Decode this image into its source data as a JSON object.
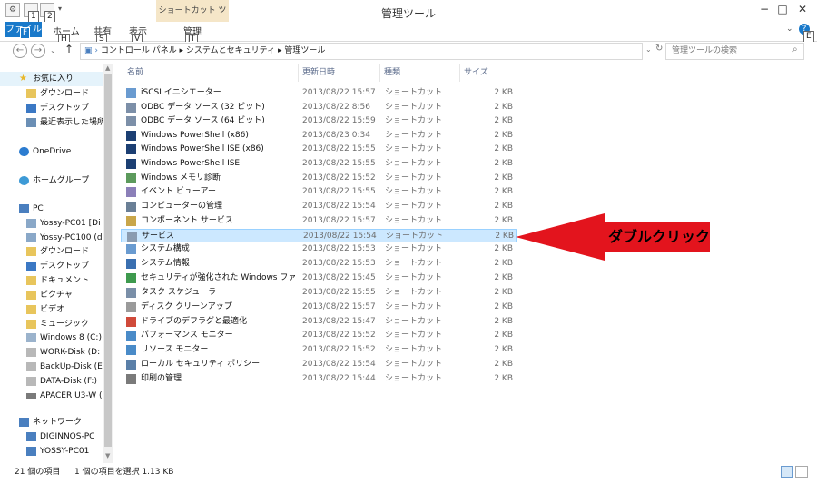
{
  "window": {
    "title": "管理ツール",
    "context_tab": "ショートカット ツール",
    "minimize": "−",
    "maximize": "□",
    "close": "✕"
  },
  "quick_access": {
    "keytip1": "1",
    "keytip2": "2"
  },
  "ribbon": {
    "file": "ファイル",
    "file_keytip": "F",
    "tabs": [
      {
        "label": "ホーム",
        "keytip": "H"
      },
      {
        "label": "共有",
        "keytip": "S"
      },
      {
        "label": "表示",
        "keytip": "V"
      },
      {
        "label": "管理",
        "keytip": "JT"
      }
    ],
    "help_keytip": "E"
  },
  "address": {
    "path": "コントロール パネル ▸ システムとセキュリティ ▸ 管理ツール",
    "search_placeholder": "管理ツールの検索"
  },
  "nav": {
    "favorites": "お気に入り",
    "fav_items": [
      "ダウンロード",
      "デスクトップ",
      "最近表示した場所"
    ],
    "onedrive": "OneDrive",
    "homegroup": "ホームグループ",
    "pc": "PC",
    "pc_items": [
      "Yossy-PC01 [Di",
      "Yossy-PC100 (d",
      "ダウンロード",
      "デスクトップ",
      "ドキュメント",
      "ピクチャ",
      "ビデオ",
      "ミュージック",
      "Windows 8 (C:)",
      "WORK-Disk (D:",
      "BackUp-Disk (E",
      "DATA-Disk (F:)",
      "APACER U3-W ("
    ],
    "network": "ネットワーク",
    "network_items": [
      "DIGINNOS-PC",
      "YOSSY-PC01"
    ]
  },
  "columns": {
    "name": "名前",
    "date": "更新日時",
    "type": "種類",
    "size": "サイズ"
  },
  "files": [
    {
      "name": "iSCSI イニシエーター",
      "date": "2013/08/22 15:57",
      "type": "ショートカット",
      "size": "2 KB"
    },
    {
      "name": "ODBC データ ソース (32 ビット)",
      "date": "2013/08/22 8:56",
      "type": "ショートカット",
      "size": "2 KB"
    },
    {
      "name": "ODBC データ ソース (64 ビット)",
      "date": "2013/08/22 15:59",
      "type": "ショートカット",
      "size": "2 KB"
    },
    {
      "name": "Windows PowerShell (x86)",
      "date": "2013/08/23 0:34",
      "type": "ショートカット",
      "size": "2 KB"
    },
    {
      "name": "Windows PowerShell ISE (x86)",
      "date": "2013/08/22 15:55",
      "type": "ショートカット",
      "size": "2 KB"
    },
    {
      "name": "Windows PowerShell ISE",
      "date": "2013/08/22 15:55",
      "type": "ショートカット",
      "size": "2 KB"
    },
    {
      "name": "Windows メモリ診断",
      "date": "2013/08/22 15:52",
      "type": "ショートカット",
      "size": "2 KB"
    },
    {
      "name": "イベント ビューアー",
      "date": "2013/08/22 15:55",
      "type": "ショートカット",
      "size": "2 KB"
    },
    {
      "name": "コンピューターの管理",
      "date": "2013/08/22 15:54",
      "type": "ショートカット",
      "size": "2 KB"
    },
    {
      "name": "コンポーネント サービス",
      "date": "2013/08/22 15:57",
      "type": "ショートカット",
      "size": "2 KB"
    },
    {
      "name": "サービス",
      "date": "2013/08/22 15:54",
      "type": "ショートカット",
      "size": "2 KB",
      "selected": true
    },
    {
      "name": "システム構成",
      "date": "2013/08/22 15:53",
      "type": "ショートカット",
      "size": "2 KB"
    },
    {
      "name": "システム情報",
      "date": "2013/08/22 15:53",
      "type": "ショートカット",
      "size": "2 KB"
    },
    {
      "name": "セキュリティが強化された Windows ファイア...",
      "date": "2013/08/22 15:45",
      "type": "ショートカット",
      "size": "2 KB"
    },
    {
      "name": "タスク スケジューラ",
      "date": "2013/08/22 15:55",
      "type": "ショートカット",
      "size": "2 KB"
    },
    {
      "name": "ディスク クリーンアップ",
      "date": "2013/08/22 15:57",
      "type": "ショートカット",
      "size": "2 KB"
    },
    {
      "name": "ドライブのデフラグと最適化",
      "date": "2013/08/22 15:47",
      "type": "ショートカット",
      "size": "2 KB"
    },
    {
      "name": "パフォーマンス モニター",
      "date": "2013/08/22 15:52",
      "type": "ショートカット",
      "size": "2 KB"
    },
    {
      "name": "リソース モニター",
      "date": "2013/08/22 15:52",
      "type": "ショートカット",
      "size": "2 KB"
    },
    {
      "name": "ローカル セキュリティ ポリシー",
      "date": "2013/08/22 15:54",
      "type": "ショートカット",
      "size": "2 KB"
    },
    {
      "name": "印刷の管理",
      "date": "2013/08/22 15:44",
      "type": "ショートカット",
      "size": "2 KB"
    }
  ],
  "annotation": {
    "text": "ダブルクリック",
    "color": "#e3141d"
  },
  "status": {
    "count": "21 個の項目",
    "selection": "1 個の項目を選択 1.13 KB"
  },
  "colors": {
    "accent": "#1979ca",
    "selection": "#cce8ff"
  }
}
